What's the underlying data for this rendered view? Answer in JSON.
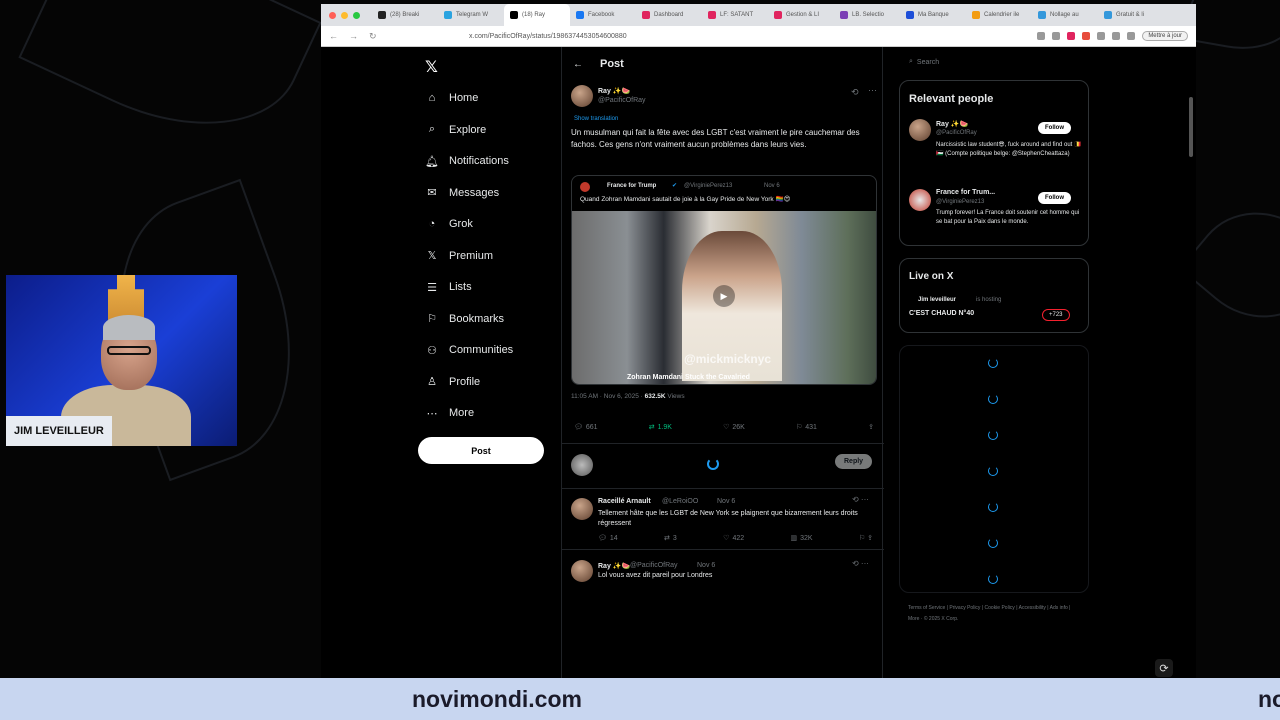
{
  "browser": {
    "tabs": [
      "(28) Breaki",
      "Telegram W",
      "(18) Ray",
      "Facebook",
      "Dashboard",
      "LF: SATANT",
      "Gestion & LI",
      "LB. Selectio",
      "Ma Banque",
      "Calendrier ile",
      "Nollage au",
      "Gratuit & li"
    ],
    "active_tab": 2,
    "url": "x.com/PacificOfRay/status/1986374453054600880",
    "update_button": "Mettre à jour"
  },
  "nav": {
    "items": [
      {
        "label": "Home",
        "icon": "home-icon"
      },
      {
        "label": "Explore",
        "icon": "search-icon"
      },
      {
        "label": "Notifications",
        "icon": "bell-icon"
      },
      {
        "label": "Messages",
        "icon": "mail-icon"
      },
      {
        "label": "Grok",
        "icon": "grok-icon"
      },
      {
        "label": "Premium",
        "icon": "x-icon"
      },
      {
        "label": "Lists",
        "icon": "list-icon"
      },
      {
        "label": "Bookmarks",
        "icon": "bookmark-icon"
      },
      {
        "label": "Communities",
        "icon": "people-icon"
      },
      {
        "label": "Profile",
        "icon": "person-icon"
      },
      {
        "label": "More",
        "icon": "more-icon"
      }
    ],
    "post_button": "Post"
  },
  "post": {
    "header": "Post",
    "author": "Ray ✨🍉",
    "handle": "@PacificOfRay",
    "translation": "Show translation",
    "text": "Un musulman qui fait la fête avec des LGBT c'est vraiment le pire cauchemar des fachos. Ces gens n'ont vraiment aucun problèmes dans leurs vies.",
    "quote": {
      "author": "France for Trump",
      "handle": "@VirginiePerez13",
      "date": "Nov 6",
      "text": "Quand Zohran Mamdani sautait de joie à la Gay Pride de New York 🏳️‍🌈😍",
      "watermark": "@mickmicknyc",
      "caption": "Zohran Mamdani Stuck the Cavalried"
    },
    "timestamp": "11:05 AM · Nov 6, 2025 · ",
    "views": "632.5K",
    "views_label": "Views",
    "stats": {
      "replies": "661",
      "reposts": "1.9K",
      "likes": "26K",
      "bookmarks": "431"
    },
    "reply_button": "Reply"
  },
  "replies": [
    {
      "author": "Raceillé Arnault",
      "handle": "@LeRoiOO",
      "date": "Nov 6",
      "text": "Tellement hâte que les LGBT de New York se plaignent que bizarrement leurs droits régressent",
      "stats": {
        "replies": "14",
        "reposts": "3",
        "likes": "422",
        "views": "32K"
      }
    },
    {
      "author": "Ray ✨🍉",
      "handle": "@PacificOfRay",
      "date": "Nov 6",
      "text": "Lol vous avez dit pareil pour Londres"
    }
  ],
  "sidebar": {
    "search_placeholder": "Search",
    "relevant_title": "Relevant people",
    "people": [
      {
        "name": "Ray ✨🍉",
        "handle": "@PacificOfRay",
        "bio": "Narcissistic law student😎, fuck around and find out 🇧🇪🇵🇸 (Compte politique belge: @StephenCheattaza)",
        "follow": "Follow"
      },
      {
        "name": "France for Trum...",
        "handle": "@VirginiePerez13",
        "bio": "Trump forever! La France doit soutenir cet homme qui se bat pour la Paix dans le monde.",
        "follow": "Follow"
      }
    ],
    "live_title": "Live on X",
    "live": {
      "host": "Jim leveilleur",
      "status": "is hosting",
      "title": "C'EST CHAUD N°40",
      "count": "+723"
    },
    "footer": [
      "Terms of Service",
      "Privacy Policy",
      "Cookie Policy",
      "Accessibility",
      "Ads info",
      "More ·",
      "© 2025 X Corp."
    ]
  },
  "webcam": {
    "name": "JIM LEVEILLEUR"
  },
  "banner": {
    "site": "novimondi.com",
    "site_repeat": "novimondi.com"
  }
}
